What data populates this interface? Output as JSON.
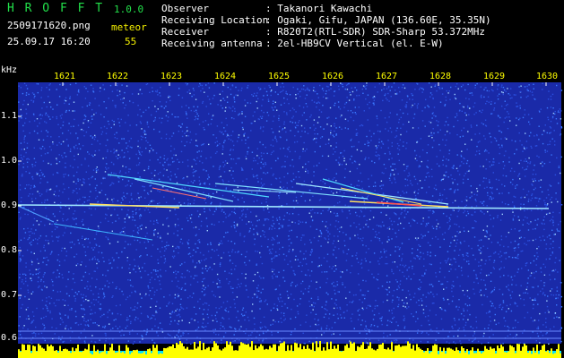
{
  "app": {
    "name": "H R O F F T",
    "version": "1.0.0"
  },
  "file": {
    "name": "2509171620.png",
    "datetime": "25.09.17 16:20"
  },
  "counter": {
    "label": "meteor",
    "value": "55"
  },
  "info": {
    "labels": [
      "Observer",
      "Receiving Location",
      "Receiver",
      "Receiving antenna"
    ],
    "values": [
      ": Takanori Kawachi",
      ": Ogaki, Gifu, JAPAN (136.60E, 35.35N)",
      ": R820T2(RTL-SDR) SDR-Sharp 53.372MHz",
      ": 2el-HB9CV Vertical (el. E-W)"
    ]
  },
  "axis": {
    "unit": "kHz",
    "x_ticks": [
      "1621",
      "1622",
      "1623",
      "1624",
      "1625",
      "1626",
      "1627",
      "1628",
      "1629",
      "1630"
    ],
    "y_ticks": [
      "1.1",
      "1.0",
      "0.9",
      "0.8",
      "0.7",
      "0.6"
    ]
  },
  "colors": {
    "background": "#1a2aa8",
    "noise": "#3a78ff",
    "signal": "#ffffff",
    "level_bar": "#ffff00",
    "base_bar": "#00e0ff"
  }
}
